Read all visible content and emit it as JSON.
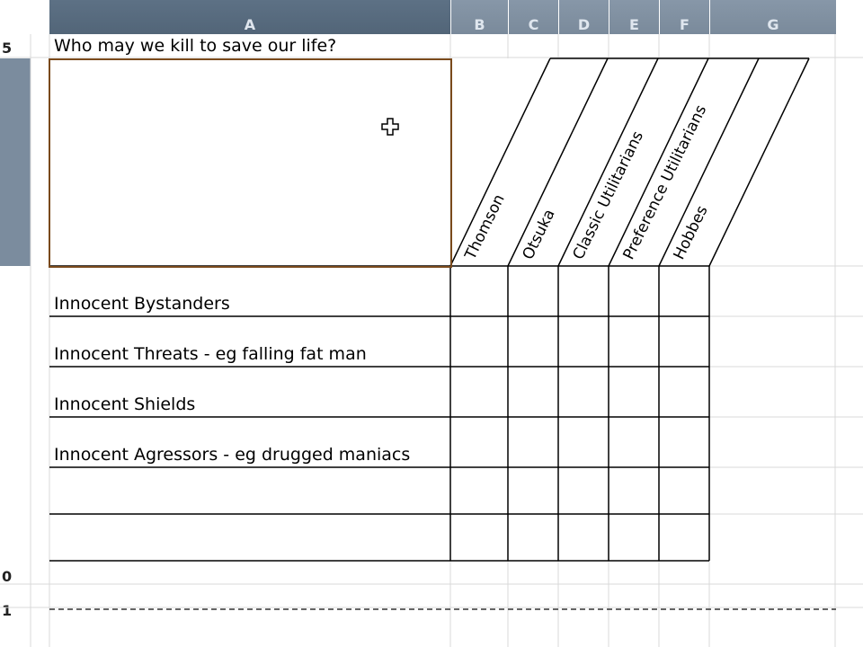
{
  "sheet": {
    "columns": [
      "A",
      "B",
      "C",
      "D",
      "E",
      "F",
      "G"
    ],
    "rows": [
      "5",
      "",
      "",
      "",
      "",
      "",
      "",
      "0",
      "1"
    ],
    "title": "Who may we kill to save our life?",
    "rotated_headers": [
      "Thomson",
      "Otsuka",
      "Classic Utilitarians",
      "Preference Utilitarians",
      "Hobbes"
    ],
    "row_labels": [
      "Innocent Bystanders",
      "Innocent Threats - eg falling fat man",
      "Innocent Shields",
      "Innocent Agressors - eg drugged maniacs"
    ]
  },
  "colors": {
    "header_bg": "#7f8fa0",
    "selected_header_bg": "#526578",
    "selection_border": "#7a4a1c",
    "grid_line": "#dddddd",
    "table_line": "#000000"
  },
  "cursor_icon": "plus-move-cursor-icon"
}
